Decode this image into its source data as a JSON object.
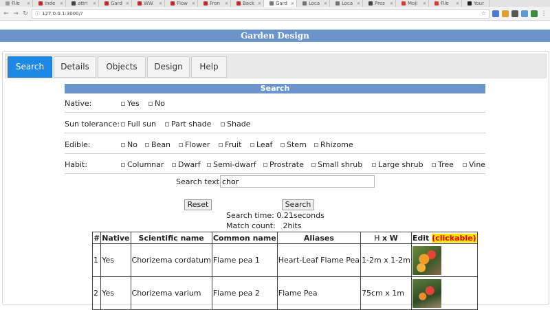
{
  "browser": {
    "tabs": [
      {
        "label": "File",
        "color": "#9e9e9e"
      },
      {
        "label": "Inde",
        "color": "#c62828"
      },
      {
        "label": "attri",
        "color": "#424242"
      },
      {
        "label": "Gard",
        "color": "#c62828"
      },
      {
        "label": "WW",
        "color": "#c62828"
      },
      {
        "label": "Flow",
        "color": "#c62828"
      },
      {
        "label": "Fron",
        "color": "#c62828"
      },
      {
        "label": "Back",
        "color": "#c62828"
      },
      {
        "label": "Gard",
        "color": "#757575"
      },
      {
        "label": "Loca",
        "color": "#757575"
      },
      {
        "label": "Loca",
        "color": "#757575"
      },
      {
        "label": "Pres",
        "color": "#424242"
      },
      {
        "label": "Moji",
        "color": "#e53935"
      },
      {
        "label": "File",
        "color": "#e53935"
      },
      {
        "label": "Your",
        "color": "#212121"
      }
    ],
    "url": "127.0.0.1:3000/?"
  },
  "app": {
    "title": "Garden Design",
    "tabs": [
      "Search",
      "Details",
      "Objects",
      "Design",
      "Help"
    ],
    "active_tab": "Search"
  },
  "search": {
    "title": "Search",
    "native": {
      "label": "Native:",
      "options": [
        "Yes",
        "No"
      ]
    },
    "sun": {
      "label": "Sun tolerance:",
      "options": [
        "Full sun",
        "Part shade",
        "Shade"
      ]
    },
    "edible": {
      "label": "Edible:",
      "options": [
        "No",
        "Bean",
        "Flower",
        "Fruit",
        "Leaf",
        "Stem",
        "Rhizome"
      ]
    },
    "habit": {
      "label": "Habit:",
      "options": [
        "Columnar",
        "Dwarf",
        "Semi-dwarf",
        "Prostrate",
        "Small shrub",
        "Large shrub",
        "Tree",
        "Vine"
      ]
    },
    "text_label": "Search text:",
    "text_value": "chor",
    "reset_label": "Reset",
    "search_label": "Search",
    "time_label": "Search time:",
    "time_value": "0.21",
    "time_unit": "seconds",
    "count_label": "Match count:",
    "count_value": "2",
    "count_unit": "hits"
  },
  "results": {
    "headers": [
      "#",
      "Native",
      "Scientific name",
      "Common name",
      "Aliases",
      "H",
      "x",
      "W",
      "Edit",
      "(clickable)"
    ],
    "rows": [
      {
        "num": "1",
        "native": "Yes",
        "scientific": "Chorizema cordatum",
        "common": "Flame pea 1",
        "aliases": "Heart-Leaf Flame Pea",
        "hw": "1-2m x 1-2m"
      },
      {
        "num": "2",
        "native": "Yes",
        "scientific": "Chorizema varium",
        "common": "Flame pea 2",
        "aliases": "Flame Pea",
        "hw": "75cm x 1m"
      }
    ]
  }
}
